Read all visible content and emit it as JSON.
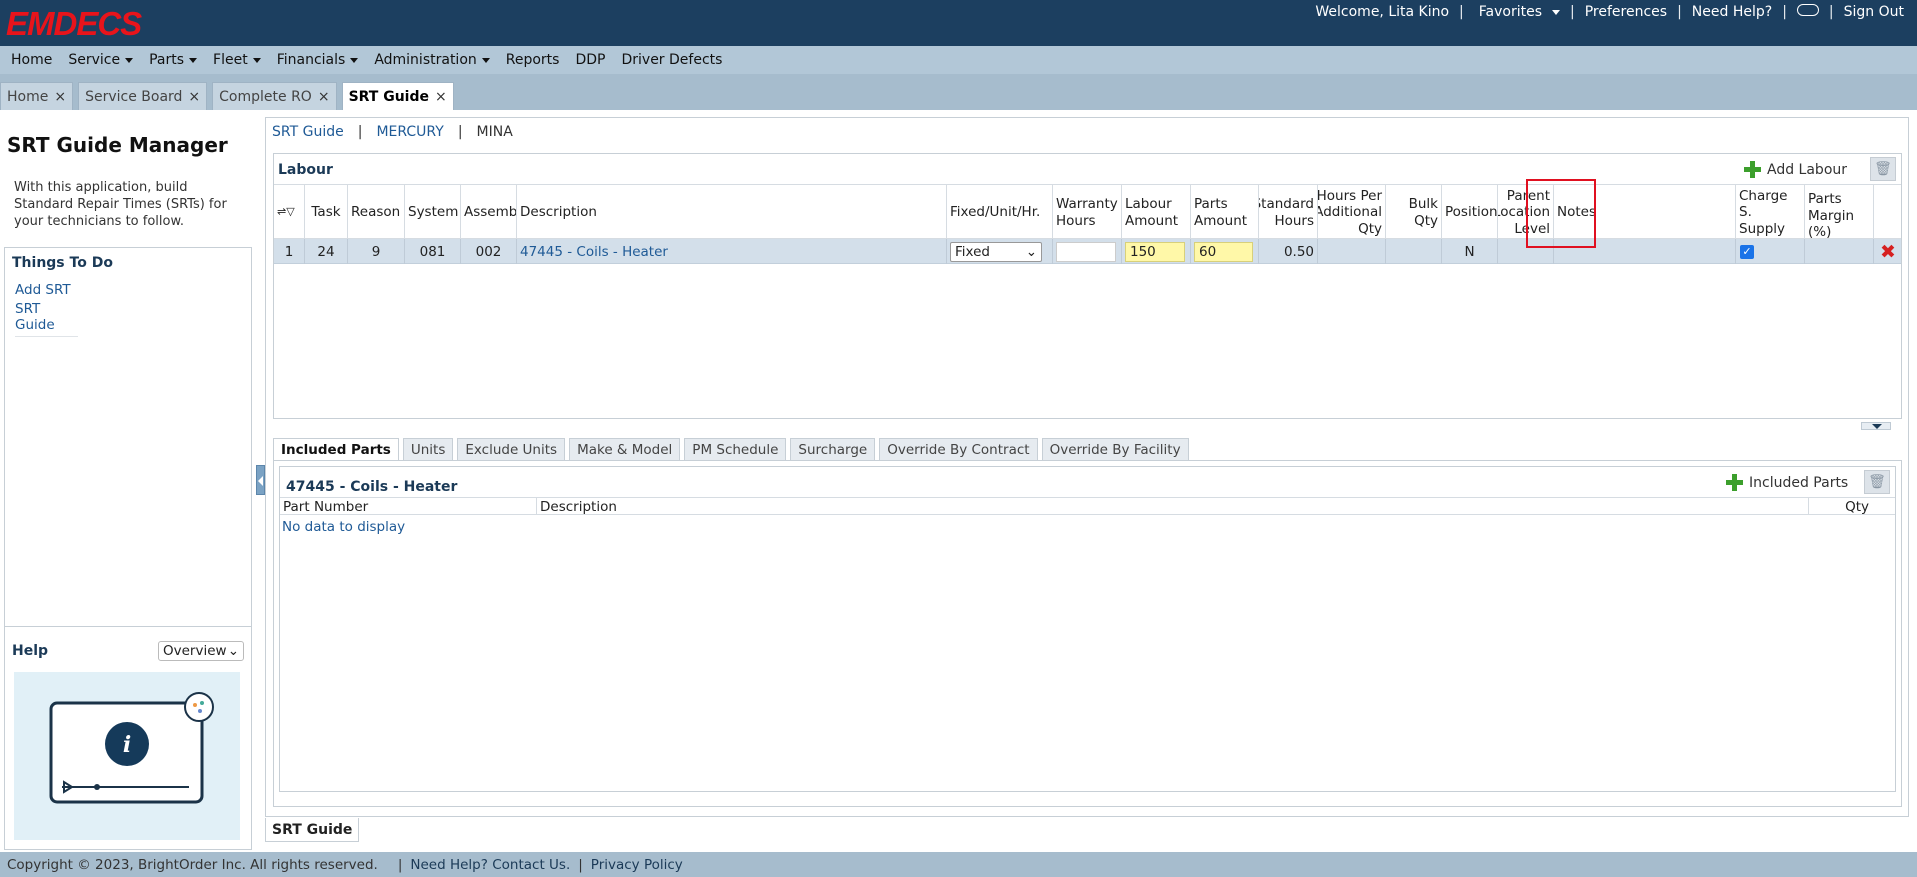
{
  "brand": {
    "logo": "EMDECS",
    "accent": "#e8141b",
    "header_bg": "#1c3f60"
  },
  "topnav": {
    "welcome": "Welcome, Lita Kino",
    "favorites": "Favorites",
    "preferences": "Preferences",
    "need_help": "Need Help?",
    "sign_out": "Sign Out"
  },
  "menu": {
    "items": [
      {
        "label": "Home",
        "dropdown": false
      },
      {
        "label": "Service",
        "dropdown": true
      },
      {
        "label": "Parts",
        "dropdown": true
      },
      {
        "label": "Fleet",
        "dropdown": true
      },
      {
        "label": "Financials",
        "dropdown": true
      },
      {
        "label": "Administration",
        "dropdown": true
      },
      {
        "label": "Reports",
        "dropdown": false
      },
      {
        "label": "DDP",
        "dropdown": false
      },
      {
        "label": "Driver Defects",
        "dropdown": false
      }
    ]
  },
  "pagetabs": [
    "Home",
    "Service Board",
    "Complete RO",
    "SRT Guide"
  ],
  "left": {
    "title": "SRT Guide Manager",
    "description": "With this application, build Standard Repair Times (SRTs) for your technicians to follow.",
    "todo_title": "Things To Do",
    "todo_links": [
      "Add SRT",
      "SRT Guide"
    ],
    "help_title": "Help",
    "help_select": "Overview"
  },
  "breadcrumb": [
    "SRT Guide",
    "MERCURY",
    "MINA"
  ],
  "labour": {
    "title": "Labour",
    "add_label": "Add Labour",
    "columns": [
      "Task",
      "Reason",
      "System",
      "Assembly",
      "Description",
      "Fixed/Unit/Hr.",
      "Warranty Hours",
      "Labour Amount",
      "Parts Amount",
      "Standard Hours",
      "Hours Per Additional Qty",
      "Bulk Qty",
      "Position",
      "Parent Location Level",
      "Notes",
      "Charge S. Supply",
      "Parts Margin (%)"
    ],
    "rows": [
      {
        "num": "1",
        "task": "24",
        "reason": "9",
        "system": "081",
        "assembly": "002",
        "description": "47445 - Coils - Heater",
        "fixed": "Fixed",
        "warranty_hours": "",
        "labour_amount": "150",
        "parts_amount": "60",
        "standard_hours": "0.50",
        "hours_per_additional": "",
        "bulk_qty": "",
        "position": "N",
        "parent_location": "",
        "notes": "",
        "charge_supply": true,
        "parts_margin": ""
      }
    ]
  },
  "subtabs": [
    "Included Parts",
    "Units",
    "Exclude Units",
    "Make & Model",
    "PM Schedule",
    "Surcharge",
    "Override By Contract",
    "Override By Facility"
  ],
  "included": {
    "title": "47445 - Coils - Heater",
    "add_label": "Included Parts",
    "columns": [
      "Part Number",
      "Description",
      "Qty"
    ],
    "empty": "No data to display"
  },
  "bottom_tab": "SRT Guide",
  "footer": {
    "copyright": "Copyright © 2023, BrightOrder Inc. All rights reserved.",
    "contact": "Need Help? Contact Us.",
    "privacy": "Privacy Policy"
  }
}
